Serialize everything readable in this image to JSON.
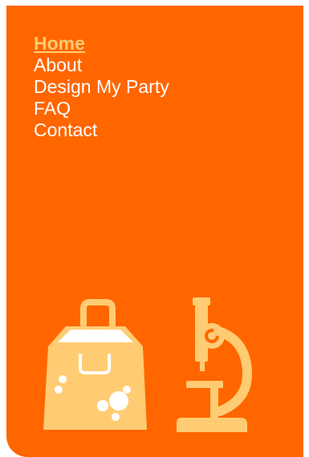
{
  "nav": {
    "items": [
      {
        "label": "Home",
        "active": true
      },
      {
        "label": "About",
        "active": false
      },
      {
        "label": "Design My Party",
        "active": false
      },
      {
        "label": "FAQ",
        "active": false
      },
      {
        "label": "Contact",
        "active": false
      }
    ]
  },
  "colors": {
    "panel_background": "#ff6600",
    "nav_text": "#ffffff",
    "nav_active": "#ffcc73",
    "illustration": "#ffcc73"
  },
  "illustrations": [
    {
      "icon": "shopping-bag-icon"
    },
    {
      "icon": "microscope-icon"
    }
  ]
}
